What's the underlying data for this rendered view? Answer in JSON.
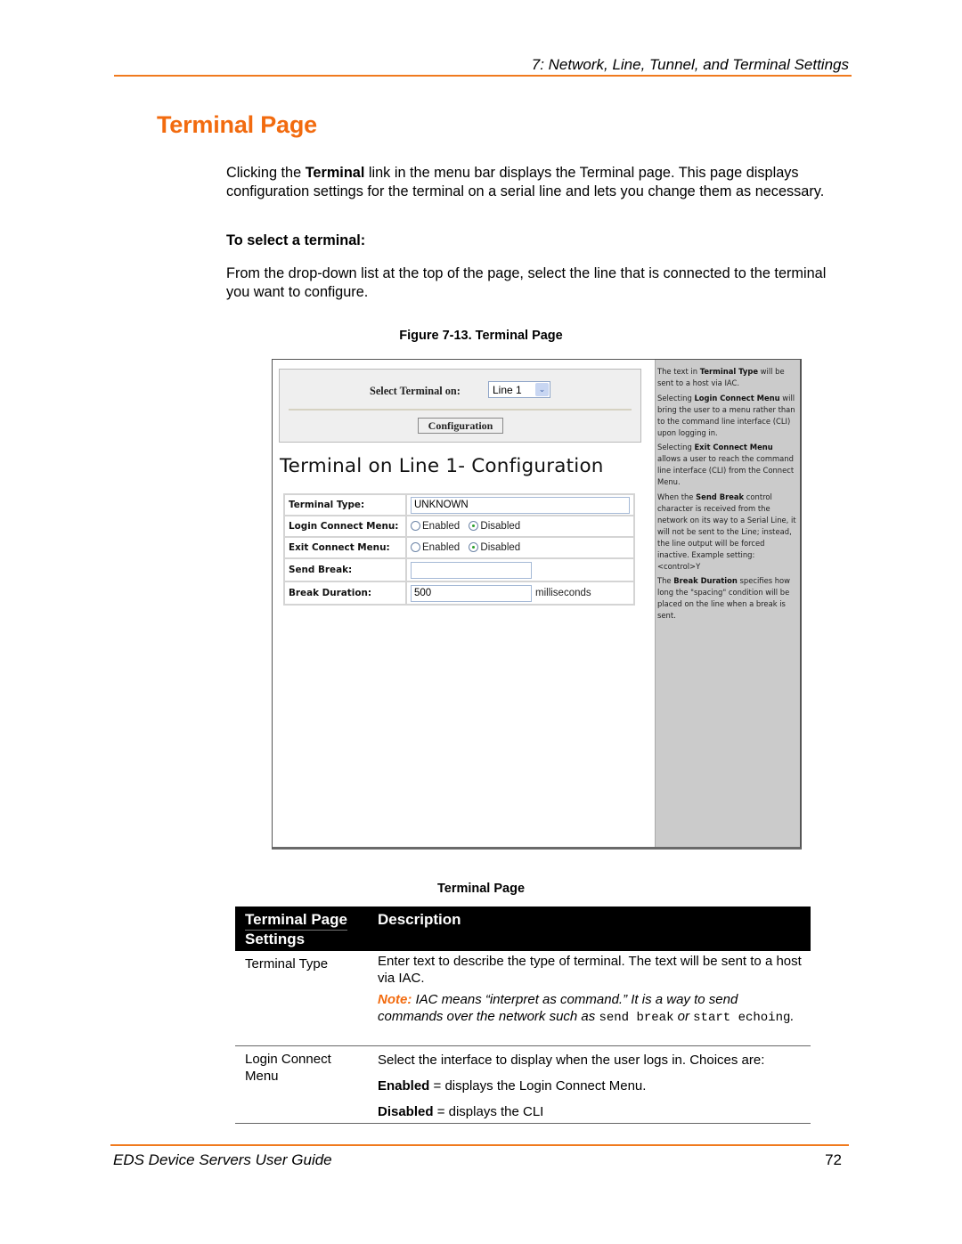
{
  "header": {
    "running_head": "7: Network, Line, Tunnel, and Terminal Settings"
  },
  "section": {
    "title": "Terminal Page",
    "intro": {
      "before": "Clicking the ",
      "bold": "Terminal",
      "after": " link in the menu bar displays the Terminal page. This page displays configuration settings for the terminal on a serial line and lets you change them as necessary."
    },
    "procedure_heading": "To select a terminal:",
    "procedure_text": "From the drop-down list at the top of the page, select the line that is connected to the terminal you want to configure.",
    "figure_caption": "Figure 7-13. Terminal Page"
  },
  "screenshot": {
    "select_label": "Select Terminal on:",
    "select_value": "Line 1",
    "config_button": "Configuration",
    "config_title": "Terminal on Line 1- Configuration",
    "fields": {
      "terminal_type": {
        "label": "Terminal Type:",
        "value": "UNKNOWN"
      },
      "login_connect_menu": {
        "label": "Login Connect Menu:",
        "option_enabled": "Enabled",
        "option_disabled": "Disabled",
        "selected": "Disabled"
      },
      "exit_connect_menu": {
        "label": "Exit Connect Menu:",
        "option_enabled": "Enabled",
        "option_disabled": "Disabled",
        "selected": "Disabled"
      },
      "send_break": {
        "label": "Send Break:",
        "value": ""
      },
      "break_duration": {
        "label": "Break Duration:",
        "value": "500",
        "unit": "milliseconds"
      }
    },
    "help": {
      "p1": {
        "a": "The text in ",
        "b": "Terminal Type",
        "c": " will be sent to a host via IAC."
      },
      "p2": {
        "a": "Selecting ",
        "b": "Login Connect Menu",
        "c": " will bring the user to a menu rather than to the command line interface (CLI) upon logging in."
      },
      "p3": {
        "a": "Selecting ",
        "b": "Exit Connect Menu",
        "c": " allows a user to reach the command line interface (CLI) from the Connect Menu."
      },
      "p4": {
        "a": "When the ",
        "b": "Send Break",
        "c": " control character is received from the network on its way to a Serial Line, it will not be sent to the Line; instead, the line output will be forced inactive. Example setting: <control>Y"
      },
      "p5": {
        "a": "The ",
        "b": "Break Duration",
        "c": " specifies how long the \"spacing\" condition will be placed on the line when a break is sent."
      }
    }
  },
  "settings_table": {
    "caption": "Terminal Page",
    "headers": {
      "setting_line1": "Terminal Page",
      "setting_line2": "Settings",
      "description": "Description"
    },
    "rows": [
      {
        "setting": "Terminal Type",
        "description": "Enter text to describe the type of terminal. The text will be sent to a host via IAC.",
        "note_label": "Note:",
        "note_text": " IAC means “interpret as command.” It is a way to send commands over the network such as ",
        "note_code1": "send break",
        "note_or": " or ",
        "note_code2": "start echoing",
        "note_end": "."
      },
      {
        "setting": "Login Connect Menu",
        "description": "Select the interface to display when the user logs in. Choices are:",
        "choice1_bold": "Enabled",
        "choice1_text": " = displays the Login Connect Menu.",
        "choice2_bold": "Disabled",
        "choice2_text": " = displays the CLI"
      }
    ]
  },
  "footer": {
    "title": "EDS Device Servers User Guide",
    "page_number": "72"
  },
  "colors": {
    "accent": "#f26b0f",
    "table_header_bg": "#000000",
    "help_panel_bg": "#cbcbcb"
  }
}
